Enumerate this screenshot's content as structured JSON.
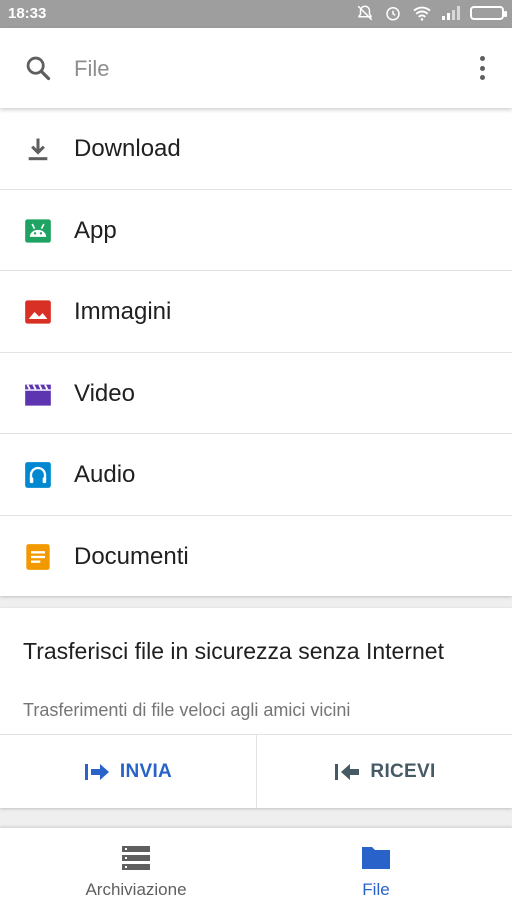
{
  "status_bar": {
    "time": "18:33"
  },
  "search": {
    "placeholder": "File",
    "icon": "search-icon",
    "menu_icon": "more-vert-icon"
  },
  "categories": [
    {
      "label": "Download",
      "icon": "download-icon",
      "color": "#5f5f5f"
    },
    {
      "label": "App",
      "icon": "android-icon",
      "color": "#1ea362"
    },
    {
      "label": "Immagini",
      "icon": "image-icon",
      "color": "#d93025"
    },
    {
      "label": "Video",
      "icon": "video-clapper-icon",
      "color": "#5e35b1"
    },
    {
      "label": "Audio",
      "icon": "headphones-icon",
      "color": "#0288d1"
    },
    {
      "label": "Documenti",
      "icon": "document-icon",
      "color": "#f29900"
    }
  ],
  "transfer": {
    "title": "Trasferisci file in sicurezza senza Internet",
    "subtitle": "Trasferimenti di file veloci agli amici vicini",
    "send_label": "INVIA",
    "receive_label": "RICEVI",
    "send_color": "#2962c9",
    "receive_color": "#455a64"
  },
  "bottom_nav": {
    "items": [
      {
        "label": "Archiviazione",
        "icon": "storage-icon",
        "active": false
      },
      {
        "label": "File",
        "icon": "folder-icon",
        "active": true
      }
    ],
    "accent": "#2962c9"
  }
}
